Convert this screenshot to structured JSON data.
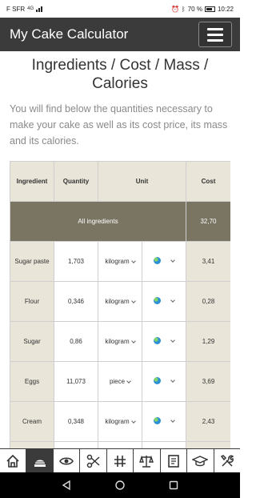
{
  "status_bar": {
    "carrier": "F SFR",
    "network": "4G",
    "battery": "70 %",
    "time": "10:22"
  },
  "app_bar": {
    "title": "My Cake Calculator"
  },
  "heading": "Ingredients / Cost / Mass / Calories",
  "intro": "You will find below the quantities necessary to make your cake as well as its cost price, its mass and its calories.",
  "table": {
    "headers": {
      "ingredient": "Ingredient",
      "quantity": "Quantity",
      "unit": "Unit",
      "cost": "Cost"
    },
    "all_row": {
      "label": "All ingredients",
      "cost": "32,70"
    },
    "rows": [
      {
        "ingredient": "Sugar paste",
        "quantity": "1,703",
        "unit": "kilogram",
        "cost": "3,41"
      },
      {
        "ingredient": "Flour",
        "quantity": "0,346",
        "unit": "kilogram",
        "cost": "0,28"
      },
      {
        "ingredient": "Sugar",
        "quantity": "0,86",
        "unit": "kilogram",
        "cost": "1,29"
      },
      {
        "ingredient": "Eggs",
        "quantity": "11,073",
        "unit": "piece",
        "cost": "3,69"
      },
      {
        "ingredient": "Cream",
        "quantity": "0,348",
        "unit": "kilogram",
        "cost": "2,43"
      }
    ]
  },
  "bottom_nav": {
    "items": [
      "home-icon",
      "cake-icon",
      "eye-icon",
      "scissors-icon",
      "grid-icon",
      "scale-icon",
      "book-icon",
      "graduation-cap-icon",
      "tools-icon"
    ],
    "active_index": 1
  },
  "colors": {
    "app_bar": "#3b3b3b",
    "table_header": "#e9e5d8",
    "all_row": "#7a7462"
  }
}
